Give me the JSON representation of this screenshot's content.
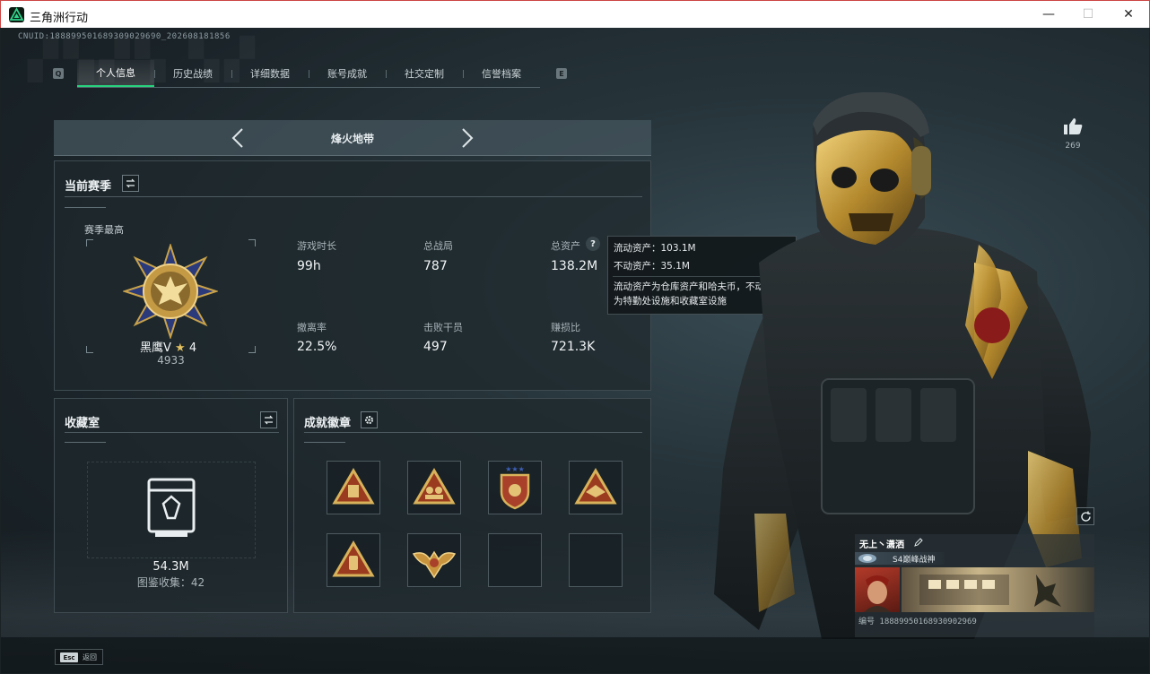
{
  "window": {
    "title": "三角洲行动",
    "minimize": "—",
    "maximize": "☐",
    "close": "✕"
  },
  "uid_text": "CNUID:1888995016893090296​90_202608181856",
  "tabs": [
    {
      "label": "个人信息",
      "active": true
    },
    {
      "label": "历史战绩",
      "active": false
    },
    {
      "label": "详细数据",
      "active": false
    },
    {
      "label": "账号成就",
      "active": false
    },
    {
      "label": "社交定制",
      "active": false
    },
    {
      "label": "信誉档案",
      "active": false
    }
  ],
  "tab_keys": {
    "prev": "Q",
    "next": "E"
  },
  "mode": {
    "title": "烽火地带"
  },
  "season": {
    "title": "当前赛季",
    "best_label": "赛季最高",
    "rank_name": "黑鹰V",
    "rank_stars": "4",
    "rank_score": "4933",
    "stats": [
      {
        "label": "游戏时长",
        "value": "99h"
      },
      {
        "label": "总战局",
        "value": "787"
      },
      {
        "label": "总资产",
        "value": "138.2M"
      },
      {
        "label": "撤离率",
        "value": "22.5%"
      },
      {
        "label": "击败干员",
        "value": "497"
      },
      {
        "label": "赚损比",
        "value": "721.3K"
      }
    ]
  },
  "tooltip": {
    "liquid": "流动资产：103.1M",
    "fixed": "不动资产：35.1M",
    "desc1": "流动资产为仓库资产和哈夫币，不动资产",
    "desc2": "为特勤处设施和收藏室设施"
  },
  "collection": {
    "title": "收藏室",
    "value": "54.3M",
    "catalog": "图鉴收集：42"
  },
  "achievements": {
    "title": "成就徽章",
    "badges": [
      {
        "icon": "ammo-badge-icon",
        "filled": true
      },
      {
        "icon": "squad-badge-icon",
        "filled": true
      },
      {
        "icon": "shield-badge-icon",
        "filled": true
      },
      {
        "icon": "eagle-badge-icon",
        "filled": true
      },
      {
        "icon": "supply-badge-icon",
        "filled": true
      },
      {
        "icon": "winged-badge-icon",
        "filled": true
      },
      {
        "icon": "empty-slot",
        "filled": false
      },
      {
        "icon": "empty-slot",
        "filled": false
      }
    ]
  },
  "profile": {
    "likes": "269",
    "name": "无上丶潇洒",
    "title_tag": "S4巅峰战神",
    "id_text": "编号 18889950168930902969"
  },
  "bottom": {
    "esc_key": "Esc",
    "esc_label": "返回"
  },
  "colors": {
    "accent": "#28d27e",
    "gold": "#c9a24a"
  }
}
